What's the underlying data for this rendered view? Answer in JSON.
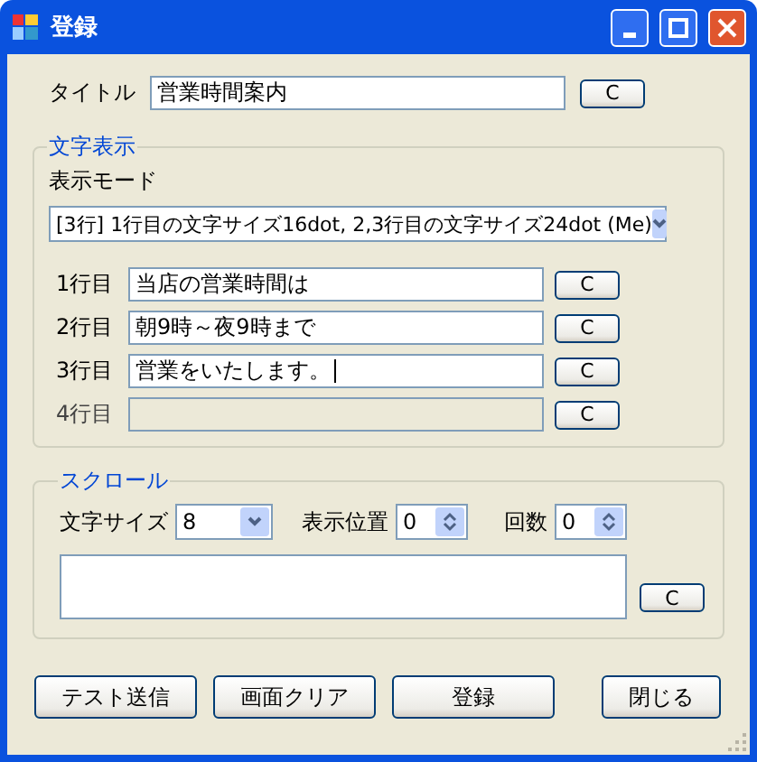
{
  "window": {
    "title": "登録"
  },
  "title_field": {
    "label": "タイトル",
    "value": "営業時間案内",
    "clear_button": "C"
  },
  "display_group": {
    "title": "文字表示",
    "mode_label": "表示モード",
    "mode_value": "[3行] 1行目の文字サイズ16dot, 2,3行目の文字サイズ24dot (Me)",
    "lines": [
      {
        "label": "1行目",
        "value": "当店の営業時間は",
        "disabled": false,
        "focused": false,
        "clear_button": "C"
      },
      {
        "label": "2行目",
        "value": "朝9時～夜9時まで",
        "disabled": false,
        "focused": false,
        "clear_button": "C"
      },
      {
        "label": "3行目",
        "value": "営業をいたします。",
        "disabled": false,
        "focused": true,
        "clear_button": "C"
      },
      {
        "label": "4行目",
        "disabled": true,
        "focused": false,
        "clear_button": "C"
      }
    ]
  },
  "scroll_group": {
    "title": "スクロール",
    "font_size_label": "文字サイズ",
    "font_size_value": "8",
    "position_label": "表示位置",
    "position_value": "0",
    "count_label": "回数",
    "count_value": "0",
    "clear_button": "C"
  },
  "buttons": [
    "テスト送信",
    "画面クリア",
    "登録",
    "閉じる"
  ]
}
